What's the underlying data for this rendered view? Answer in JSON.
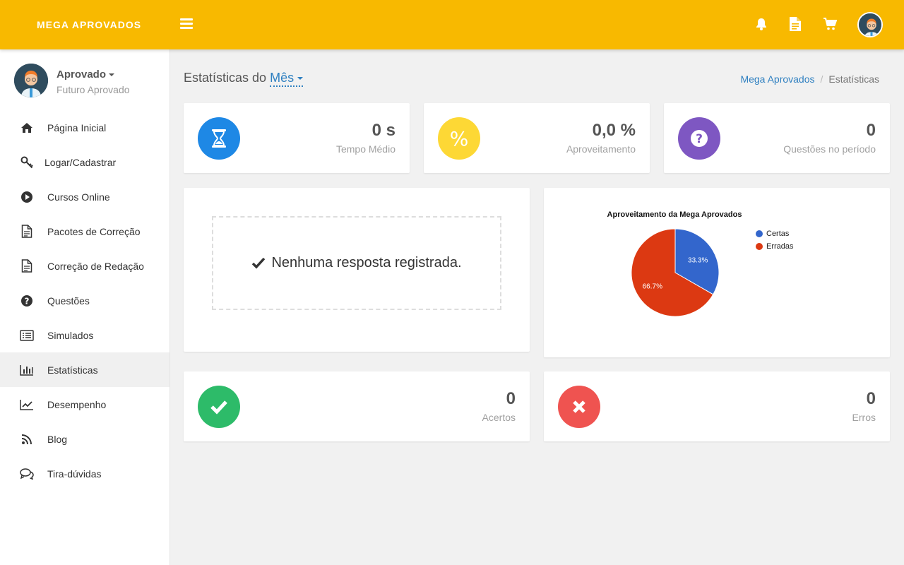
{
  "header": {
    "brand": "MEGA APROVADOS",
    "icons": [
      "menu-icon",
      "bell-icon",
      "document-icon",
      "cart-icon",
      "avatar"
    ]
  },
  "user": {
    "name": "Aprovado",
    "subtitle": "Futuro Aprovado"
  },
  "sidebar": {
    "items": [
      {
        "label": "Página Inicial",
        "icon": "home-icon"
      },
      {
        "label": "Logar/Cadastrar",
        "icon": "key-icon"
      },
      {
        "label": "Cursos Online",
        "icon": "play-circle-icon"
      },
      {
        "label": "Pacotes de Correção",
        "icon": "file-icon"
      },
      {
        "label": "Correção de Redação",
        "icon": "file-icon"
      },
      {
        "label": "Questões",
        "icon": "question-circle-icon"
      },
      {
        "label": "Simulados",
        "icon": "list-icon"
      },
      {
        "label": "Estatísticas",
        "icon": "bar-chart-icon",
        "active": true
      },
      {
        "label": "Desempenho",
        "icon": "line-chart-icon"
      },
      {
        "label": "Blog",
        "icon": "rss-icon"
      },
      {
        "label": "Tira-dúvidas",
        "icon": "comments-icon"
      }
    ]
  },
  "page": {
    "title_prefix": "Estatísticas do",
    "period": "Mês",
    "breadcrumb": {
      "home": "Mega Aprovados",
      "current": "Estatísticas"
    }
  },
  "stats": {
    "tempo": {
      "value": "0 s",
      "label": "Tempo Médio",
      "color": "#1e88e5"
    },
    "aproveitamento": {
      "value": "0,0 %",
      "label": "Aproveitamento",
      "color": "#fdd835",
      "symbol": "%"
    },
    "questoes": {
      "value": "0",
      "label": "Questões no período",
      "color": "#7e57c2",
      "symbol": "?"
    },
    "acertos": {
      "value": "0",
      "label": "Acertos",
      "color": "#2dbb69"
    },
    "erros": {
      "value": "0",
      "label": "Erros",
      "color": "#ef5350"
    }
  },
  "empty_message": "Nenhuma resposta registrada.",
  "chart_data": {
    "type": "pie",
    "title": "Aproveitamento da Mega Aprovados",
    "labels": [
      "Certas",
      "Erradas"
    ],
    "values": [
      33.3,
      66.7
    ],
    "value_labels": [
      "33.3%",
      "66.7%"
    ],
    "colors": [
      "#3366cc",
      "#dc3912"
    ],
    "legend": "right"
  }
}
